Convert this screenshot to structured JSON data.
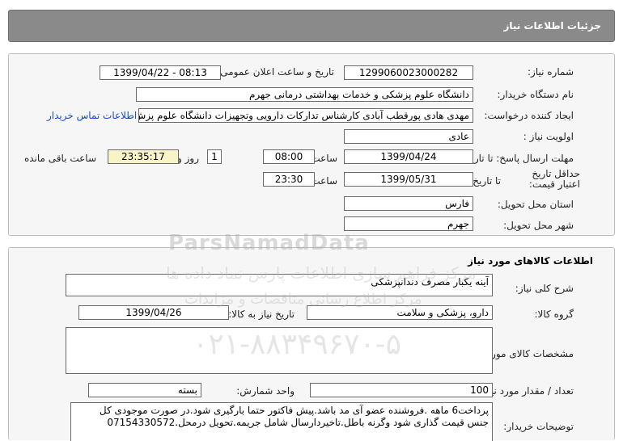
{
  "header": {
    "title": "جزئیات اطلاعات نیاز"
  },
  "info": {
    "need_number_label": "شماره نیاز:",
    "need_number": "1299060023000282",
    "announce_label": "تاریخ و ساعت اعلان عمومی:",
    "announce_value": "1399/04/22 - 08:13",
    "buyer_label": "نام دستگاه خریدار:",
    "buyer_value": "دانشگاه علوم پزشکی و خدمات بهداشتی درمانی جهرم",
    "creator_label": "ایجاد کننده درخواست:",
    "creator_value": "مهدی هادی پورقطب آبادی کارشناس تدارکات دارویی وتجهیزات دانشگاه علوم پزش",
    "contact_link": "اطلاعات تماس خریدار",
    "priority_label": "اولویت نیاز :",
    "priority_value": "عادی",
    "deadline_label": "مهلت ارسال پاسخ: تا تاریخ :",
    "deadline_date": "1399/04/24",
    "time_label": "ساعت",
    "deadline_time": "08:00",
    "days_value": "1",
    "days_label": "روز و",
    "remaining_time": "23:35:17",
    "remaining_label": "ساعت باقی مانده",
    "validity_label": "حداقل تاریخ اعتبار قیمت:",
    "validity_to_label": "تا تاریخ :",
    "validity_date": "1399/05/31",
    "validity_time": "23:30",
    "province_label": "استان محل تحویل:",
    "province_value": "فارس",
    "city_label": "شهر محل تحویل:",
    "city_value": "جهرم"
  },
  "goods": {
    "title": "اطلاعات کالاهای مورد نیاز",
    "desc_label": "شرح کلی نیاز:",
    "desc_value": "آینه یکبار مصرف دندانپزشکی",
    "group_label": "گروه کالا:",
    "group_value": "دارو، پزشکی و سلامت",
    "need_date_label": "تاریخ نیاز به کالا:",
    "need_date_value": "1399/04/26",
    "spec_label": "مشخصات کالای مورد نیاز:",
    "spec_value": "",
    "qty_label": "تعداد / مقدار مورد نیاز:",
    "qty_value": "100",
    "unit_label": "واحد شمارش:",
    "unit_value": "بسته",
    "notes_label": "توضیحات خریدار:",
    "notes_line1": "پرداخت6 ماهه .فروشنده عضو آی مد باشد.پیش فاکتور حتما بارگیری شود.در صورت موجودی کل",
    "notes_line2": "جنس قیمت گذاری شود وگرنه باطل.تاخیردارسال شامل جریمه.تحویل درمحل.07154330572"
  },
  "watermark": {
    "brand": "ParsNamadData",
    "line1": "مرکز فراهم سازی اطلاعات پارس نماد داده ها",
    "line2": "مرکز اطلاع رسانی مناقصات و مزایدات",
    "phone": "۰۲۱-۸۸۳۴۹۶۷۰-۵"
  }
}
